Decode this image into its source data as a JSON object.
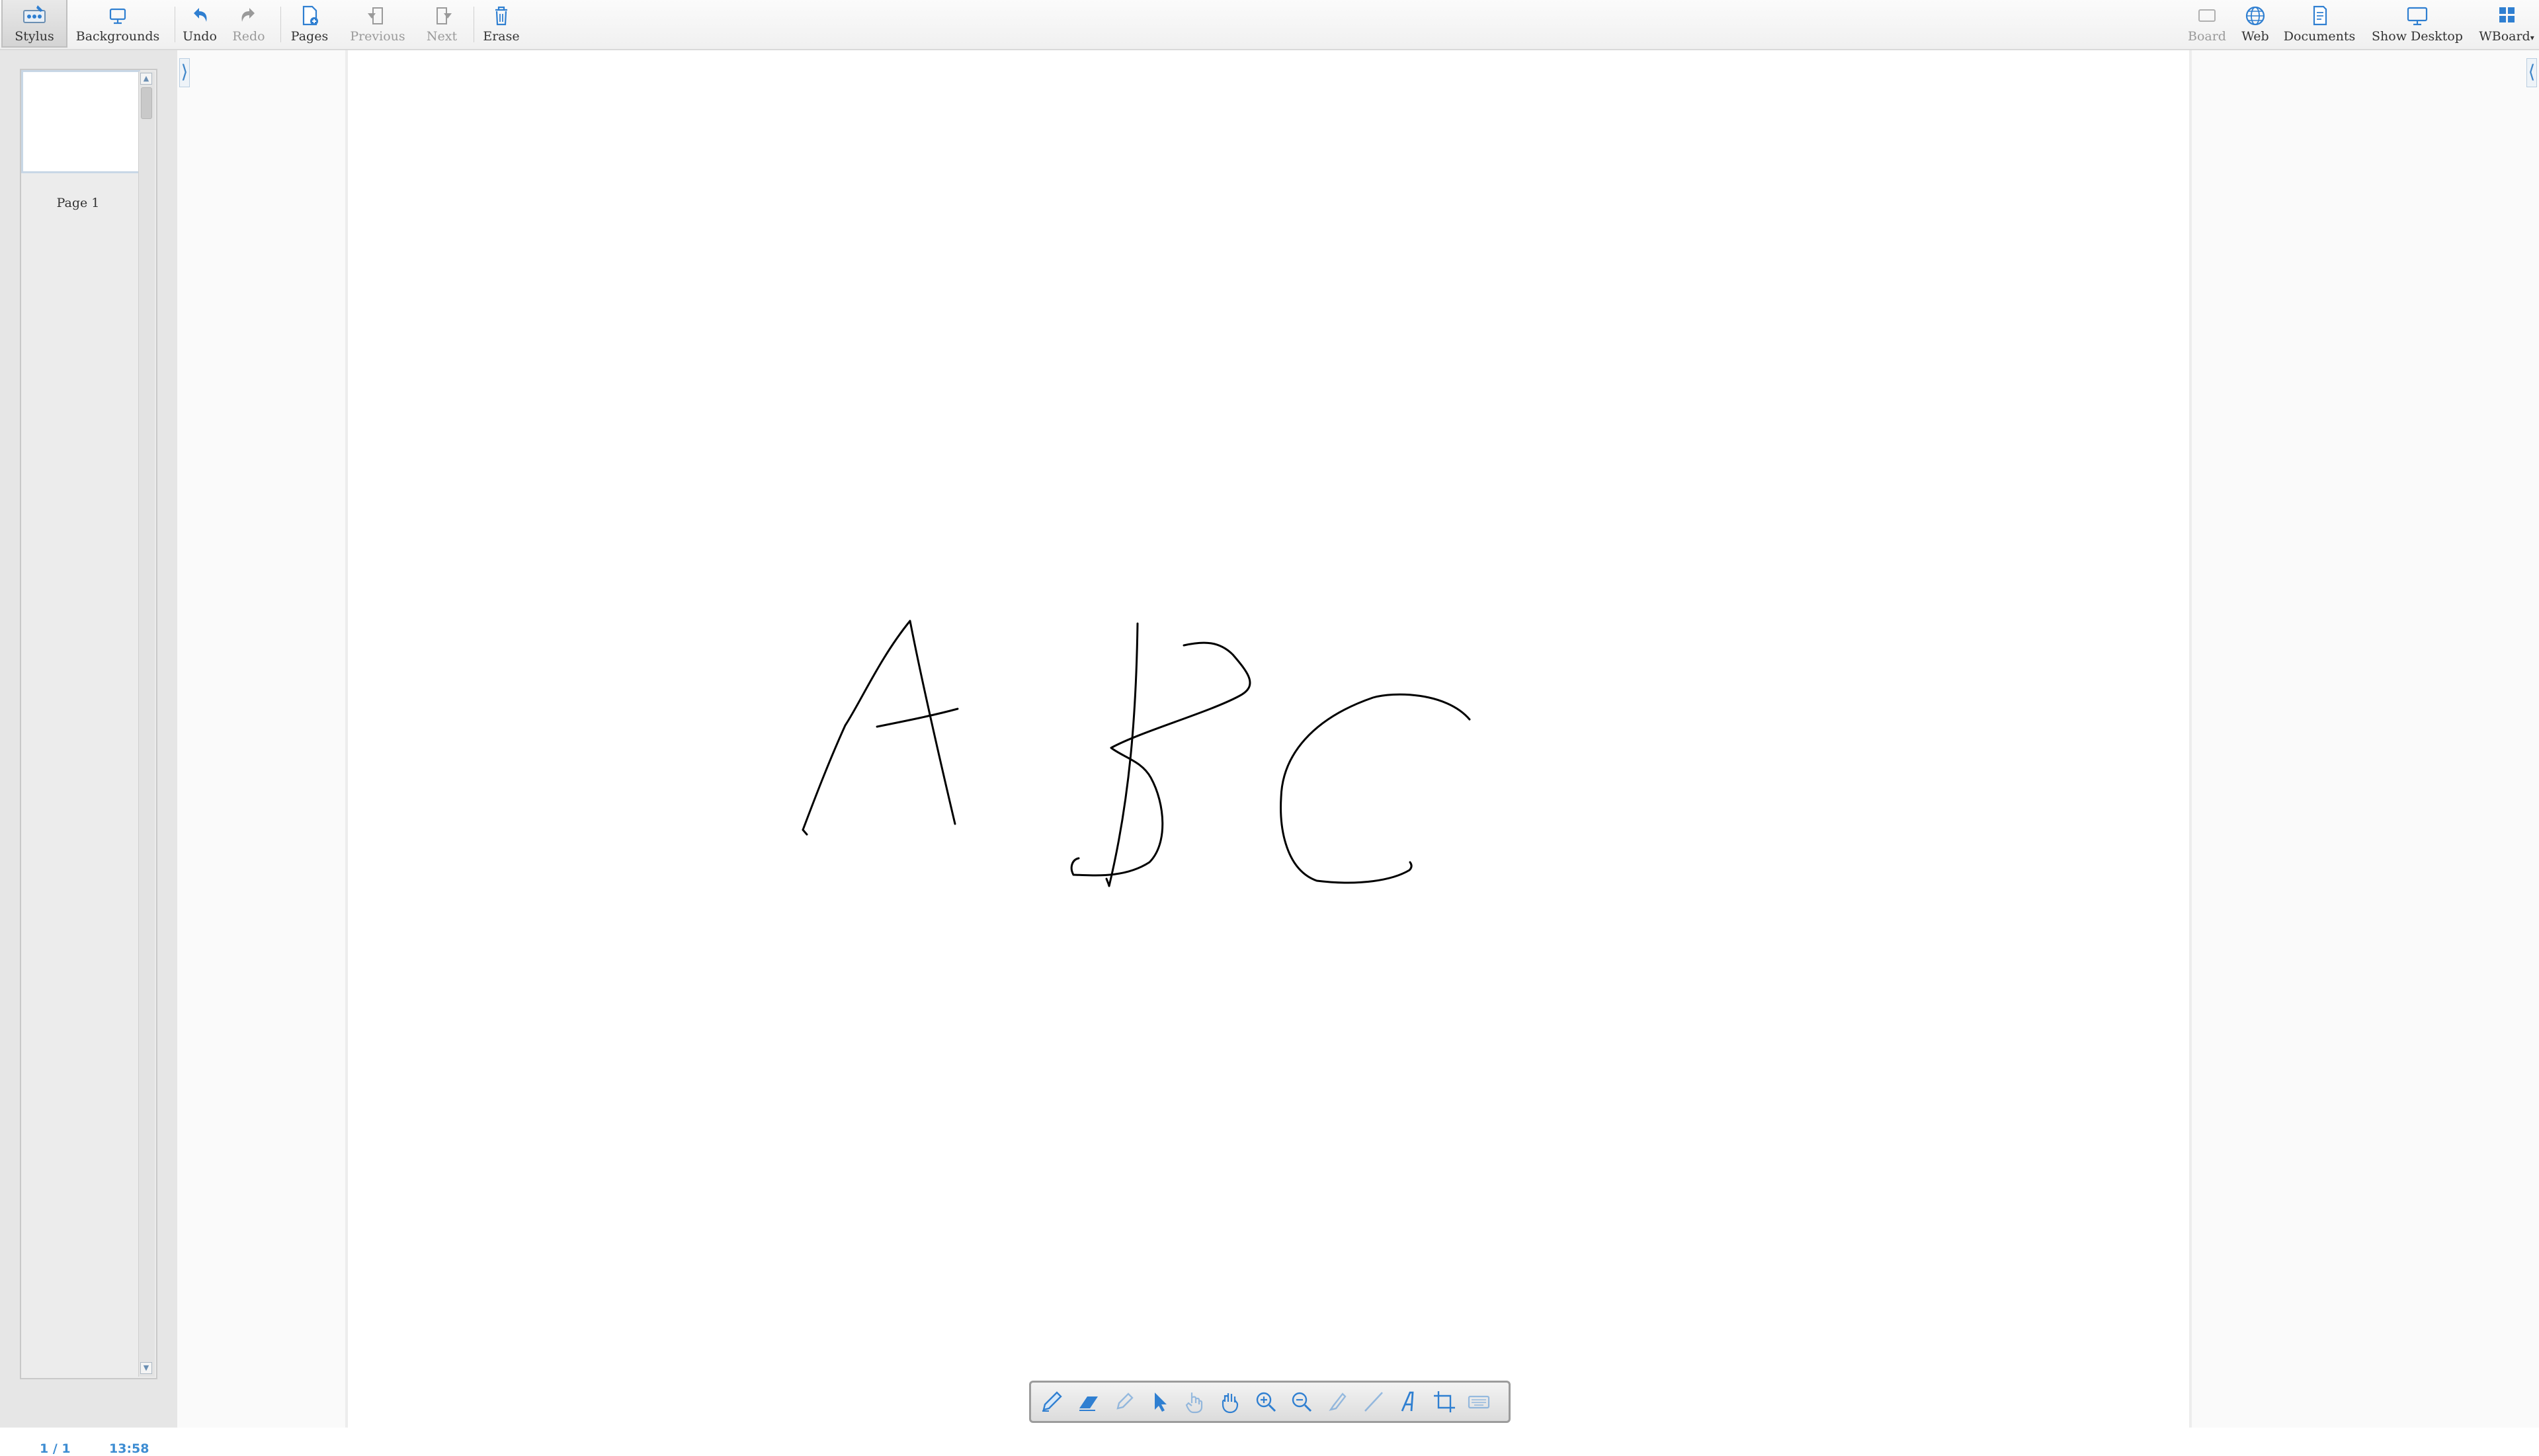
{
  "toolbar": {
    "left": [
      {
        "id": "stylus",
        "label": "Stylus",
        "icon": "stylus-icon",
        "active": true
      },
      {
        "id": "backgrounds",
        "label": "Backgrounds",
        "icon": "backgrounds-icon"
      },
      {
        "id": "undo",
        "label": "Undo",
        "icon": "undo-icon"
      },
      {
        "id": "redo",
        "label": "Redo",
        "icon": "redo-icon",
        "disabled": true
      },
      {
        "id": "pages",
        "label": "Pages",
        "icon": "pages-icon"
      },
      {
        "id": "previous",
        "label": "Previous",
        "icon": "previous-icon",
        "disabled": true
      },
      {
        "id": "next",
        "label": "Next",
        "icon": "next-icon",
        "disabled": true
      },
      {
        "id": "erase",
        "label": "Erase",
        "icon": "trash-icon"
      }
    ],
    "right": [
      {
        "id": "board",
        "label": "Board",
        "icon": "board-icon",
        "disabled": true
      },
      {
        "id": "web",
        "label": "Web",
        "icon": "globe-icon"
      },
      {
        "id": "documents",
        "label": "Documents",
        "icon": "documents-icon"
      },
      {
        "id": "show_desktop",
        "label": "Show Desktop",
        "icon": "desktop-icon"
      },
      {
        "id": "wboard",
        "label": "WBoard",
        "icon": "grid-icon"
      }
    ]
  },
  "thumbnails": {
    "pages": [
      {
        "label": "Page 1"
      }
    ]
  },
  "status": {
    "page_counter": "1 / 1",
    "clock": "13:58"
  },
  "palette": {
    "tools": [
      {
        "id": "pen",
        "icon": "pen-icon"
      },
      {
        "id": "eraser",
        "icon": "eraser-icon"
      },
      {
        "id": "marker",
        "icon": "marker-icon",
        "disabled": true
      },
      {
        "id": "selector",
        "icon": "arrow-cursor-icon"
      },
      {
        "id": "interact",
        "icon": "pointing-hand-icon",
        "disabled": true
      },
      {
        "id": "hand",
        "icon": "hand-icon"
      },
      {
        "id": "zoom_in",
        "icon": "zoom-in-icon"
      },
      {
        "id": "zoom_out",
        "icon": "zoom-out-icon"
      },
      {
        "id": "laser",
        "icon": "laser-pointer-icon",
        "disabled": true
      },
      {
        "id": "line",
        "icon": "line-icon",
        "disabled": true
      },
      {
        "id": "text",
        "icon": "text-icon"
      },
      {
        "id": "capture",
        "icon": "capture-icon"
      },
      {
        "id": "keyboard",
        "icon": "keyboard-icon",
        "disabled": true
      }
    ]
  },
  "colors": {
    "accent": "#2f7fd1",
    "ink": "#000000"
  }
}
